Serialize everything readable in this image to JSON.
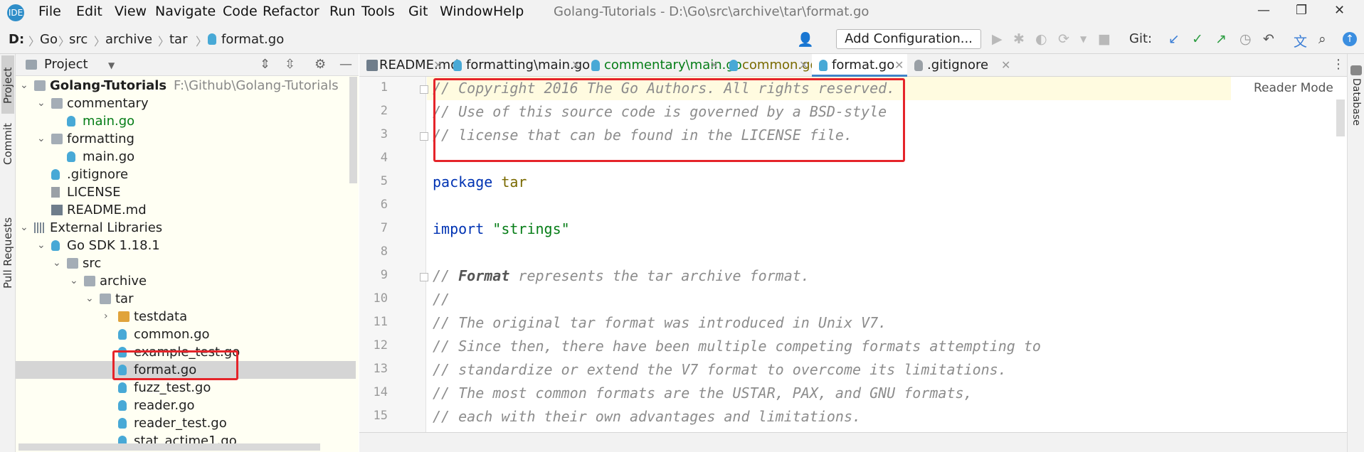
{
  "menubar": {
    "logo_text": "IDE",
    "items": [
      "File",
      "Edit",
      "View",
      "Navigate",
      "Code",
      "Refactor",
      "Run",
      "Tools",
      "Git",
      "Window",
      "Help"
    ],
    "title": "Golang-Tutorials - D:\\Go\\src\\archive\\tar\\format.go",
    "window_controls": [
      "—",
      "❐",
      "✕"
    ]
  },
  "navbar": {
    "crumbs": [
      "D:",
      "Go",
      "src",
      "archive",
      "tar",
      "format.go"
    ],
    "add_configuration": "Add Configuration...",
    "git_label": "Git:"
  },
  "left_strip": {
    "tabs": [
      "Project",
      "Commit",
      "Pull Requests"
    ]
  },
  "right_strip": {
    "tabs": [
      "Database"
    ]
  },
  "project": {
    "header": "Project",
    "tree": [
      {
        "label": "Golang-Tutorials",
        "extra": "F:\\Github\\Golang-Tutorials",
        "icon": "folder",
        "arrow": "v",
        "bold": true
      },
      {
        "label": "commentary",
        "icon": "folder",
        "arrow": "v"
      },
      {
        "label": "main.go",
        "icon": "go-file",
        "color": "#067d17"
      },
      {
        "label": "formatting",
        "icon": "folder",
        "arrow": "v"
      },
      {
        "label": "main.go",
        "icon": "go-file"
      },
      {
        "label": ".gitignore",
        "icon": "go-file"
      },
      {
        "label": "LICENSE",
        "icon": "text-file"
      },
      {
        "label": "README.md",
        "icon": "md-file"
      },
      {
        "label": "External Libraries",
        "icon": "library",
        "arrow": "v"
      },
      {
        "label": "Go SDK 1.18.1",
        "icon": "go-file",
        "arrow": "v"
      },
      {
        "label": "src",
        "icon": "folder",
        "arrow": "v"
      },
      {
        "label": "archive",
        "icon": "folder",
        "arrow": "v"
      },
      {
        "label": "tar",
        "icon": "folder",
        "arrow": "v"
      },
      {
        "label": "testdata",
        "icon": "folder-orange",
        "arrow": ">"
      },
      {
        "label": "common.go",
        "icon": "go-file"
      },
      {
        "label": "example_test.go",
        "icon": "go-file"
      },
      {
        "label": "format.go",
        "icon": "go-file",
        "selected": true
      },
      {
        "label": "fuzz_test.go",
        "icon": "go-file"
      },
      {
        "label": "reader.go",
        "icon": "go-file"
      },
      {
        "label": "reader_test.go",
        "icon": "go-file"
      },
      {
        "label": "stat_actime1.go",
        "icon": "go-file"
      }
    ]
  },
  "editor": {
    "tabs": [
      {
        "label": "README.md",
        "color": "#1f1f1f"
      },
      {
        "label": "formatting\\main.go",
        "color": "#1f1f1f"
      },
      {
        "label": "commentary\\main.go",
        "color": "#067d17"
      },
      {
        "label": "common.go",
        "color": "#7a6a00"
      },
      {
        "label": "format.go",
        "color": "#1f1f1f",
        "active": true
      },
      {
        "label": ".gitignore",
        "color": "#1f1f1f"
      }
    ],
    "reader_mode": "Reader Mode",
    "line_numbers": [
      "1",
      "2",
      "3",
      "4",
      "5",
      "6",
      "7",
      "8",
      "9",
      "10",
      "11",
      "12",
      "13",
      "14",
      "15"
    ],
    "lines": [
      "// Copyright 2016 The Go Authors. All rights reserved.",
      "// Use of this source code is governed by a BSD-style",
      "// license that can be found in the LICENSE file.",
      "",
      "package tar",
      "",
      "import \"strings\"",
      "",
      "// Format represents the tar archive format.",
      "//",
      "// The original tar format was introduced in Unix V7.",
      "// Since then, there have been multiple competing formats attempting to",
      "// standardize or extend the V7 format to overcome its limitations.",
      "// The most common formats are the USTAR, PAX, and GNU formats,",
      "// each with their own advantages and limitations."
    ],
    "tokens": {
      "package_kw": "package",
      "package_name": "tar",
      "import_kw": "import",
      "import_str": "\"strings\"",
      "format_comment_prefix": "// ",
      "format_comment_bold": "Format",
      "format_comment_rest": " represents the tar archive format."
    }
  },
  "colors": {
    "highlight": "#e5242a",
    "accent": "#4083c9",
    "selection": "#d5d5d5"
  }
}
